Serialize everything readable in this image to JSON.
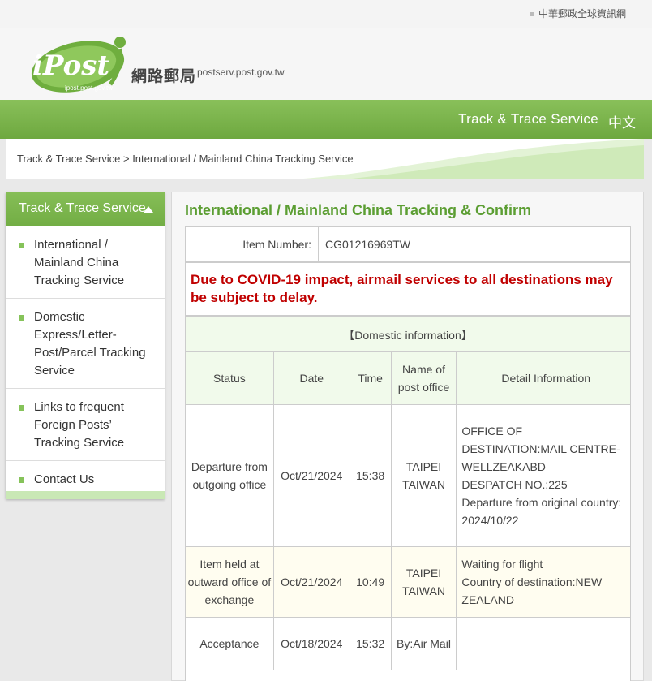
{
  "topbar": {
    "link": "中華郵政全球資訊網"
  },
  "header": {
    "logo_text": "iPost",
    "logo_subtext": "ipost.post.gov.tw",
    "site_name_cn": "網路郵局",
    "site_url": "postserv.post.gov.tw"
  },
  "servicebar": {
    "title": "Track & Trace Service",
    "lang": "中文"
  },
  "breadcrumb": {
    "text": "Track & Trace Service > International / Mainland China Tracking Service"
  },
  "sidebar": {
    "heading": "Track & Trace Service",
    "items": [
      {
        "label": "International / Mainland China Tracking Service"
      },
      {
        "label": "Domestic Express/Letter-Post/Parcel Tracking Service"
      },
      {
        "label": "Links to frequent Foreign Posts’ Tracking Service"
      },
      {
        "label": "Contact Us"
      }
    ]
  },
  "main": {
    "title": "International / Mainland China Tracking & Confirm",
    "item_number_label": "Item Number:",
    "item_number_value": "CG01216969TW",
    "notice": "Due to COVID-19 impact, airmail services to all destinations may be subject to delay.",
    "domestic_title": "【Domestic information】",
    "columns": [
      "Status",
      "Date",
      "Time",
      "Name of post office",
      "Detail Information"
    ],
    "rows": [
      {
        "status": "Departure from outgoing office",
        "date": "Oct/21/2024",
        "time": "15:38",
        "office": "TAIPEI TAIWAN",
        "detail_lines": [
          "OFFICE OF DESTINATION:MAIL CENTRE-WELLZEAKABD",
          "DESPATCH NO.:225",
          "Departure from original country:",
          "2024/10/22"
        ]
      },
      {
        "status": "Item held at outward office of exchange",
        "date": "Oct/21/2024",
        "time": "10:49",
        "office": "TAIPEI TAIWAN",
        "detail_lines": [
          "Waiting for flight",
          "Country of destination:NEW ZEALAND"
        ]
      },
      {
        "status": "Acceptance",
        "date": "Oct/18/2024",
        "time": "15:32",
        "office": "By:Air Mail",
        "detail_lines": []
      }
    ]
  },
  "colors": {
    "brand_green": "#72ad44",
    "title_green": "#5c9e33",
    "notice_red": "#c00000"
  }
}
